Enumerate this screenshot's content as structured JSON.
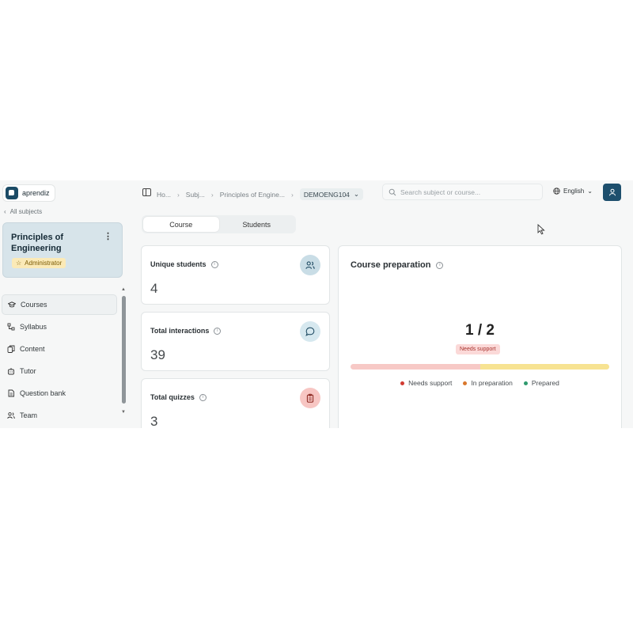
{
  "sidebar": {
    "logo_text": "aprendiz",
    "back_label": "All subjects",
    "subject": {
      "title": "Principles of Engineering",
      "role": "Administrator"
    },
    "nav": [
      {
        "label": "Courses",
        "icon": "graduation-cap-icon",
        "active": true
      },
      {
        "label": "Syllabus",
        "icon": "tree-icon",
        "active": false
      },
      {
        "label": "Content",
        "icon": "files-icon",
        "active": false
      },
      {
        "label": "Tutor",
        "icon": "robot-icon",
        "active": false
      },
      {
        "label": "Question bank",
        "icon": "document-icon",
        "active": false
      },
      {
        "label": "Team",
        "icon": "users-icon",
        "active": false
      }
    ]
  },
  "header": {
    "breadcrumbs": [
      "Ho...",
      "Subj...",
      "Principles of Engine...",
      "DEMOENG104"
    ],
    "search_placeholder": "Search subject or course...",
    "language": "English"
  },
  "tabs": [
    {
      "label": "Course",
      "active": true
    },
    {
      "label": "Students",
      "active": false
    }
  ],
  "stats": [
    {
      "label": "Unique students",
      "value": "4",
      "icon": "users-icon",
      "color": "#c9dde6"
    },
    {
      "label": "Total interactions",
      "value": "39",
      "icon": "chat-bubble-icon",
      "color": "#d6e8ef"
    },
    {
      "label": "Total quizzes",
      "value": "3",
      "icon": "clipboard-icon",
      "color": "#f7c6c3"
    }
  ],
  "preparation": {
    "title": "Course preparation",
    "value": "1 / 2",
    "badge": "Needs support",
    "progress": {
      "needs_support": 0.5,
      "in_preparation": 0.5,
      "prepared": 0
    },
    "legend": [
      {
        "label": "Needs support",
        "color": "#d13b32"
      },
      {
        "label": "In preparation",
        "color": "#d9772c"
      },
      {
        "label": "Prepared",
        "color": "#2f9a6e"
      }
    ]
  },
  "colors": {
    "brand": "#1d4f6d",
    "subject_card": "#d7e4ea",
    "badge_bg": "#fbeab7"
  }
}
